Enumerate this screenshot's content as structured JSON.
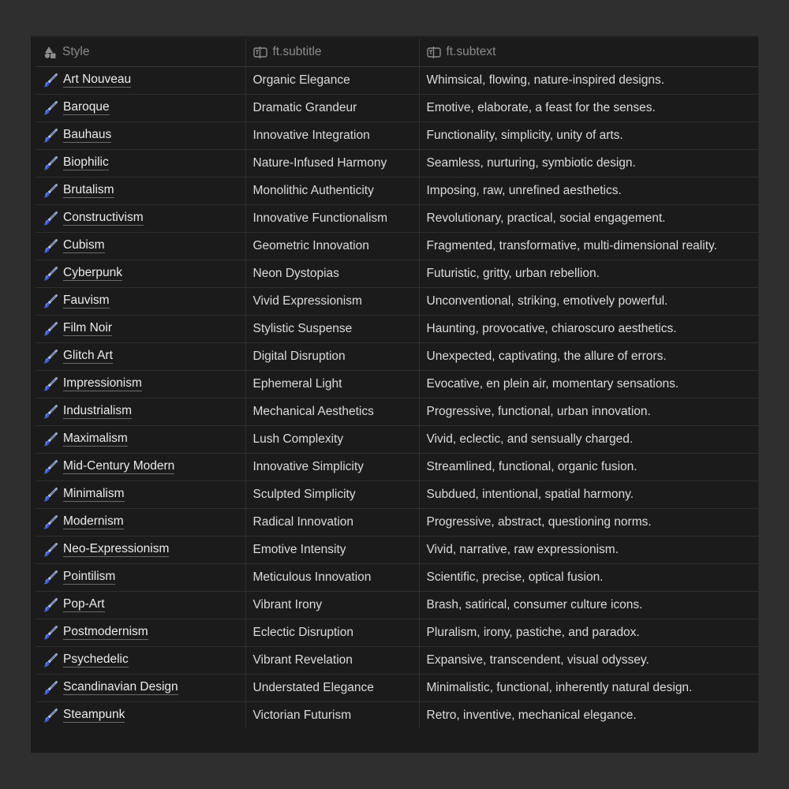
{
  "columns": [
    {
      "label": "Style",
      "icon": "shapes-icon"
    },
    {
      "label": "ft.subtitle",
      "icon": "text-columns-icon"
    },
    {
      "label": "ft.subtext",
      "icon": "text-columns-icon"
    }
  ],
  "rows": [
    {
      "style": "Art Nouveau",
      "subtitle": "Organic Elegance",
      "subtext": "Whimsical, flowing, nature-inspired designs."
    },
    {
      "style": "Baroque",
      "subtitle": "Dramatic Grandeur",
      "subtext": "Emotive, elaborate, a feast for the senses."
    },
    {
      "style": "Bauhaus",
      "subtitle": "Innovative Integration",
      "subtext": "Functionality, simplicity, unity of arts."
    },
    {
      "style": "Biophilic",
      "subtitle": "Nature-Infused Harmony",
      "subtext": "Seamless, nurturing, symbiotic design."
    },
    {
      "style": "Brutalism",
      "subtitle": "Monolithic Authenticity",
      "subtext": "Imposing, raw, unrefined aesthetics."
    },
    {
      "style": "Constructivism",
      "subtitle": "Innovative Functionalism",
      "subtext": "Revolutionary, practical, social engagement."
    },
    {
      "style": "Cubism",
      "subtitle": "Geometric Innovation",
      "subtext": "Fragmented, transformative, multi-dimensional reality."
    },
    {
      "style": "Cyberpunk",
      "subtitle": "Neon Dystopias",
      "subtext": "Futuristic, gritty, urban rebellion."
    },
    {
      "style": "Fauvism",
      "subtitle": "Vivid Expressionism",
      "subtext": "Unconventional, striking, emotively powerful."
    },
    {
      "style": "Film Noir",
      "subtitle": "Stylistic Suspense",
      "subtext": "Haunting, provocative, chiaroscuro aesthetics."
    },
    {
      "style": "Glitch Art",
      "subtitle": "Digital Disruption",
      "subtext": "Unexpected, captivating, the allure of errors."
    },
    {
      "style": "Impressionism",
      "subtitle": "Ephemeral Light",
      "subtext": "Evocative, en plein air, momentary sensations."
    },
    {
      "style": "Industrialism",
      "subtitle": "Mechanical Aesthetics",
      "subtext": "Progressive, functional, urban innovation."
    },
    {
      "style": "Maximalism",
      "subtitle": "Lush Complexity",
      "subtext": "Vivid, eclectic, and sensually charged."
    },
    {
      "style": "Mid-Century Modern",
      "subtitle": "Innovative Simplicity",
      "subtext": "Streamlined, functional, organic fusion."
    },
    {
      "style": "Minimalism",
      "subtitle": "Sculpted Simplicity",
      "subtext": "Subdued, intentional, spatial harmony."
    },
    {
      "style": "Modernism",
      "subtitle": "Radical Innovation",
      "subtext": "Progressive, abstract, questioning norms."
    },
    {
      "style": "Neo-Expressionism",
      "subtitle": "Emotive Intensity",
      "subtext": "Vivid, narrative, raw expressionism."
    },
    {
      "style": "Pointilism",
      "subtitle": "Meticulous Innovation",
      "subtext": "Scientific, precise, optical fusion."
    },
    {
      "style": "Pop-Art",
      "subtitle": "Vibrant Irony",
      "subtext": "Brash, satirical, consumer culture icons."
    },
    {
      "style": "Postmodernism",
      "subtitle": "Eclectic Disruption",
      "subtext": "Pluralism, irony, pastiche, and paradox."
    },
    {
      "style": "Psychedelic",
      "subtitle": "Vibrant Revelation",
      "subtext": "Expansive, transcendent, visual odyssey."
    },
    {
      "style": "Scandinavian Design",
      "subtitle": "Understated Elegance",
      "subtext": "Minimalistic, functional, inherently natural design."
    },
    {
      "style": "Steampunk",
      "subtitle": "Victorian Futurism",
      "subtext": "Retro, inventive, mechanical elegance."
    }
  ],
  "row_icon": "paintbrush-icon",
  "colors": {
    "background": "#2f2f2f",
    "table": "#1b1b1b",
    "text": "#dcdcdc",
    "header_text": "#8c8c8c"
  }
}
